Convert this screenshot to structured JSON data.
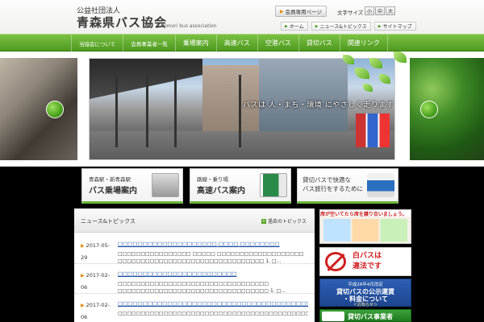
{
  "header": {
    "org_sub": "公益社団法人",
    "org_name": "青森県バス協会",
    "org_en": "Aomori bus association",
    "member_btn": "会員専用ページ",
    "fontsize_label": "文字サイズ",
    "fontsize": [
      "小",
      "中",
      "大"
    ],
    "util_links": [
      "ホーム",
      "ニュース&トピックス",
      "サイトマップ"
    ]
  },
  "nav": [
    "当協会について",
    "会員事業者一覧",
    "乗場案内",
    "高速バス",
    "空港バス",
    "貸切バス",
    "関連リンク"
  ],
  "hero": {
    "caption": "バスは 人・まち・環境 にやさしく走ります"
  },
  "banners": [
    {
      "sub": "青森駅・新青森駅",
      "main": "バス乗場案内"
    },
    {
      "sub": "路線・乗り場",
      "main": "高速バス案内"
    },
    {
      "line1": "貸切バスで快適な",
      "line2": "バス旅行をするために"
    }
  ],
  "news": {
    "title": "ニュース&トピックス",
    "past": "過去のトピックス",
    "items": [
      {
        "date": "2017-05-29",
        "link": "□□□□□□□□□□□□□□□□□□□□.□□□□.□□□□□□□□",
        "body": "□□□□□□□□□□□□□□□□ □□□□□ □□□□□□□□□□□□□□□□□□□ □□□□□□□□□□□□□□□□□□□□□□□□□□□□□□□□ 1. □..."
      },
      {
        "date": "2017-02-06",
        "link": "□□□□□□□□□□□□□□□□□□□□□□□□",
        "body": "□□□□□□□□□□□□□□□□□□□□□□□□□□□□□□□□□ □□□□□□□□□□□□□□□□□□□□□□□□□□□□□□□□□ 1. □..."
      },
      {
        "date": "2017-02-06",
        "link": "□□□□□□□□□□□□□□□□□□□□□□□□□□□□□□□□□□□□□□□□□□□□□□□□□□□□□□□",
        "body": "□□□□□□□□□□□□□□□□□□□□□□□□□□□□□□□□□□□□□□□□□□□□□□□□□□□□□□□□□□□□□□□□□□□"
      }
    ]
  },
  "side": {
    "b1_header": "席が空いてたら席を譲り合いましょう。",
    "b2_line1": "白バスは",
    "b2_line2": "違法です",
    "b3_l1": "平成26年4月改定",
    "b3_l2": "貸切バスの公示運賃",
    "b3_l3": "・料金について",
    "b3_l4": "＜お知らせ＞",
    "b4": "貸切バス事業者"
  }
}
